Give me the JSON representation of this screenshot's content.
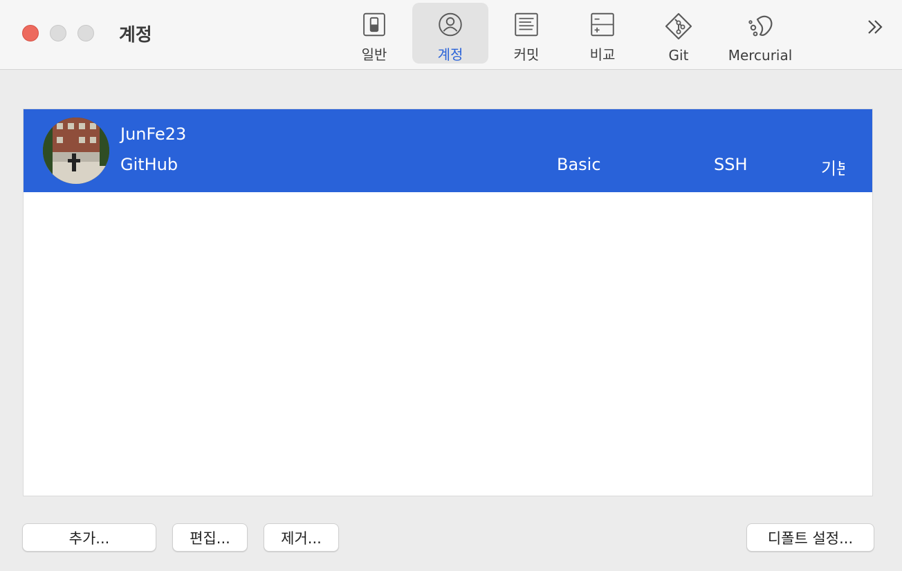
{
  "window": {
    "title": "계정"
  },
  "toolbar": {
    "tabs": [
      {
        "label": "일반",
        "icon": "switch-icon"
      },
      {
        "label": "계정",
        "icon": "person-circle-icon",
        "active": true
      },
      {
        "label": "커밋",
        "icon": "document-lines-icon"
      },
      {
        "label": "비교",
        "icon": "diff-icon"
      },
      {
        "label": "Git",
        "icon": "git-diamond-icon"
      },
      {
        "label": "Mercurial",
        "icon": "mercurial-icon"
      }
    ],
    "overflow_icon": "double-chevron-right-icon"
  },
  "accounts": [
    {
      "username": "JunFe23",
      "host": "GitHub",
      "auth": "Basic",
      "protocol": "SSH",
      "default": "기본"
    }
  ],
  "buttons": {
    "add": "추가...",
    "edit": "편집...",
    "remove": "제거...",
    "set_default": "디폴트 설정..."
  },
  "colors": {
    "selection": "#2962d9",
    "active_tab": "#2b63d8",
    "close": "#ed6a5e"
  }
}
